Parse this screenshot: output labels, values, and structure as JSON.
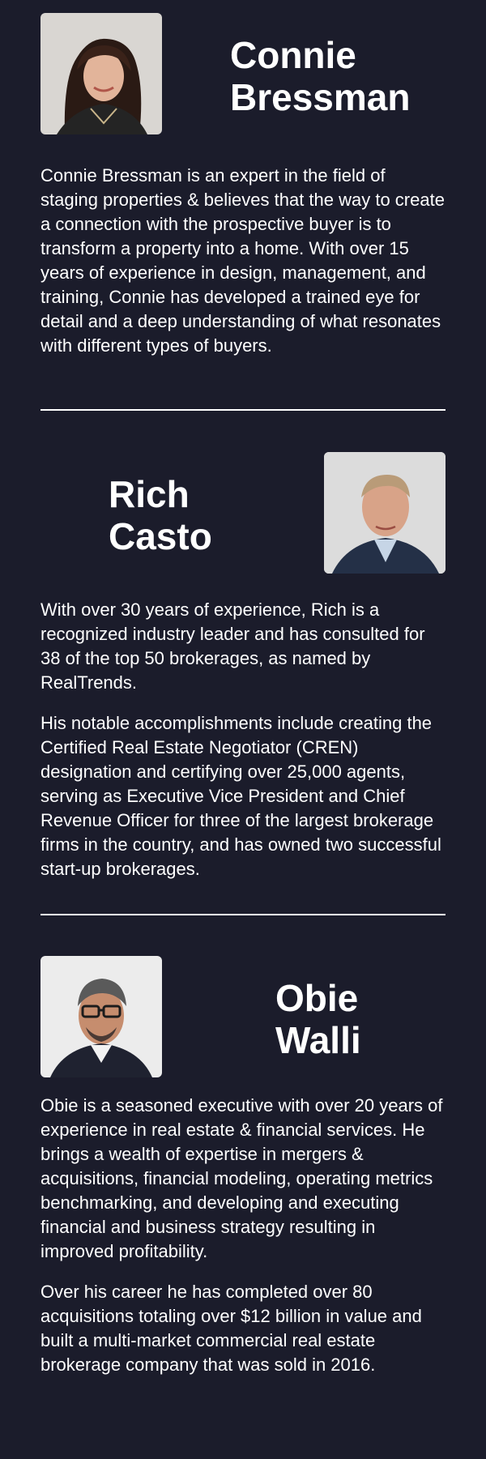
{
  "profiles": [
    {
      "first_name": "Connie",
      "last_name": "Bressman",
      "bio": [
        "Connie Bressman is an expert in the field of staging properties & believes that the way to create a connection with the prospective buyer is to transform a property into a home. With over 15 years of experience in design, management, and training, Connie has developed a trained eye for detail and a deep understanding of what resonates with different types of buyers."
      ]
    },
    {
      "first_name": "Rich",
      "last_name": "Casto",
      "bio": [
        "With over 30 years of experience, Rich is a recognized industry leader and has consulted for 38 of the top 50 brokerages, as named by RealTrends.",
        "His notable accomplishments include creating the Certified Real Estate Negotiator (CREN) designation and certifying over 25,000 agents, serving as Executive Vice President and Chief Revenue Officer for three of the largest brokerage firms in the country, and has owned two successful start-up brokerages."
      ]
    },
    {
      "first_name": "Obie",
      "last_name": "Walli",
      "bio": [
        "Obie is a seasoned executive with over 20 years of experience in real estate & financial services. He brings a wealth of expertise in mergers & acquisitions, financial modeling, operating metrics benchmarking, and developing and executing financial and business strategy resulting in improved profitability.",
        "Over his career he has completed over 80 acquisitions totaling over $12 billion in value and built a multi-market commercial real estate brokerage company that was sold in 2016."
      ]
    }
  ],
  "colors": {
    "background": "#1b1c2b",
    "text": "#ffffff",
    "divider": "#ffffff"
  }
}
